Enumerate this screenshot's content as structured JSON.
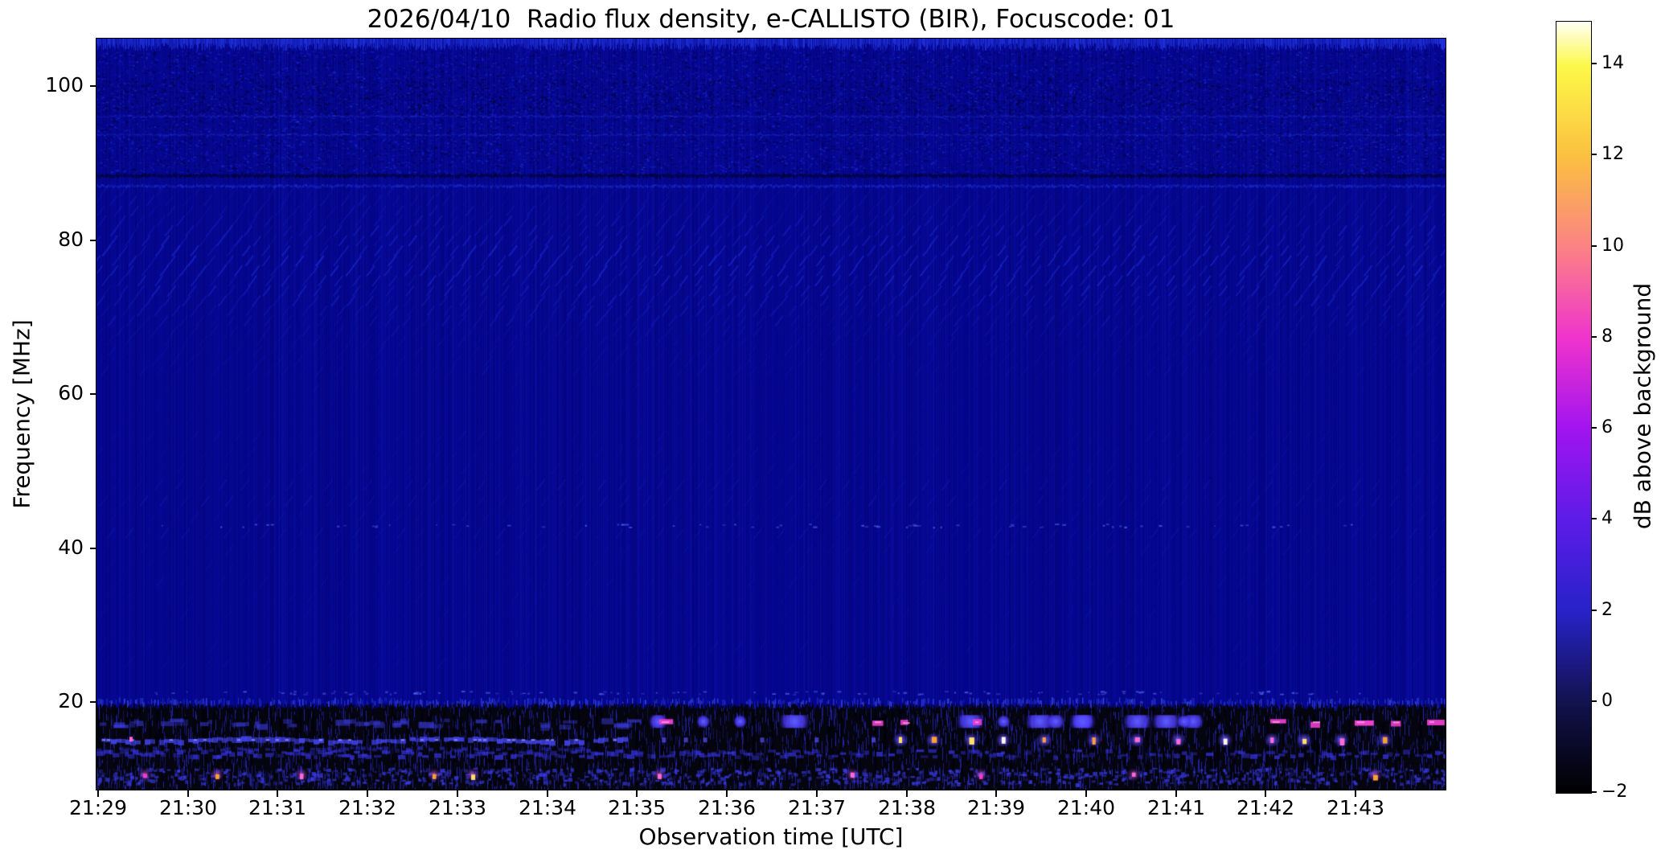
{
  "chart_data": {
    "type": "heatmap",
    "title": "2026/04/10  Radio flux density, e-CALLISTO (BIR), Focuscode: 01",
    "xlabel": "Observation time [UTC]",
    "ylabel": "Frequency [MHz]",
    "colorbar_label": "dB above background",
    "x_ticks": [
      "21:29",
      "21:30",
      "21:31",
      "21:32",
      "21:33",
      "21:34",
      "21:35",
      "21:36",
      "21:37",
      "21:38",
      "21:39",
      "21:40",
      "21:41",
      "21:42",
      "21:43"
    ],
    "y_ticks": [
      100,
      80,
      60,
      40,
      20
    ],
    "colorbar_ticks": [
      14,
      12,
      10,
      8,
      6,
      4,
      2,
      0,
      "−2"
    ],
    "value_range_db": [
      -2,
      15
    ],
    "freq_range_mhz": [
      8.65,
      106.2
    ],
    "time_span_minutes": 15,
    "grid": false,
    "colormap": "gnuplot2-like (black-blue-violet-magenta-orange-yellow-white)",
    "colormap_stops": [
      {
        "value": -2,
        "color": "#000000"
      },
      {
        "value": 0,
        "color": "#12124e"
      },
      {
        "value": 2,
        "color": "#2722c8"
      },
      {
        "value": 4,
        "color": "#5c1ce8"
      },
      {
        "value": 6,
        "color": "#a014ef"
      },
      {
        "value": 8,
        "color": "#ef33cd"
      },
      {
        "value": 10,
        "color": "#fb8186"
      },
      {
        "value": 12,
        "color": "#fbbf41"
      },
      {
        "value": 14,
        "color": "#fcf847"
      },
      {
        "value": 15,
        "color": "#fffff4"
      }
    ],
    "palette": {
      "background": "#ffffff",
      "text": "#000000",
      "base_navy": "#05068f",
      "streak_blue": "#2633e8",
      "bright_blue": "#5a5aff",
      "violet": "#7a3bff",
      "magenta": "#ee3fd0",
      "pink": "#ff6ad5",
      "hot_orange": "#ffa033",
      "hot_yellow": "#ffe066",
      "hot_white": "#fff8e8",
      "rfi_black": "#050510"
    },
    "features": [
      {
        "name": "top-comb",
        "freq_mhz": [
          104.6,
          106.2
        ],
        "desc": "bright blue vertical comb texture along top edge"
      },
      {
        "name": "fm-band-speckle",
        "freq_mhz": [
          88.6,
          104.6
        ],
        "desc": "mottled blue/dark speckle texture (FM broadcast band) with faint bright lines near 96 and 94 MHz"
      },
      {
        "name": "dark-line",
        "freq_mhz": [
          88.1,
          88.7
        ],
        "desc": "dark horizontal interference line"
      },
      {
        "name": "bright-line",
        "freq_mhz": [
          86.9,
          87.3
        ],
        "desc": "bright horizontal line"
      },
      {
        "name": "chevron-ripples",
        "freq_mhz": [
          63,
          86.5
        ],
        "desc": "diagonal ripple / chevron interference pattern, strongest 68-82 MHz"
      },
      {
        "name": "faint-ripples",
        "freq_mhz": [
          25,
          63
        ],
        "desc": "very faint diagonal striping over uniform navy background"
      },
      {
        "name": "speck-rows",
        "freqs_mhz": [
          43,
          21.3
        ],
        "desc": "sparse rows of faint bright specks"
      },
      {
        "name": "rfi-band",
        "freq_mhz": [
          8.65,
          19.6
        ],
        "rows_mhz": [
          17.5,
          15.1,
          13.5,
          10.6
        ],
        "desc": "strong broadband RFI band: near-black background, dense blue vertical streaks, blue/violet blobs, magenta dashes, and periodic hot orange/yellow/white bursts around 15 MHz after 21:38"
      }
    ]
  }
}
